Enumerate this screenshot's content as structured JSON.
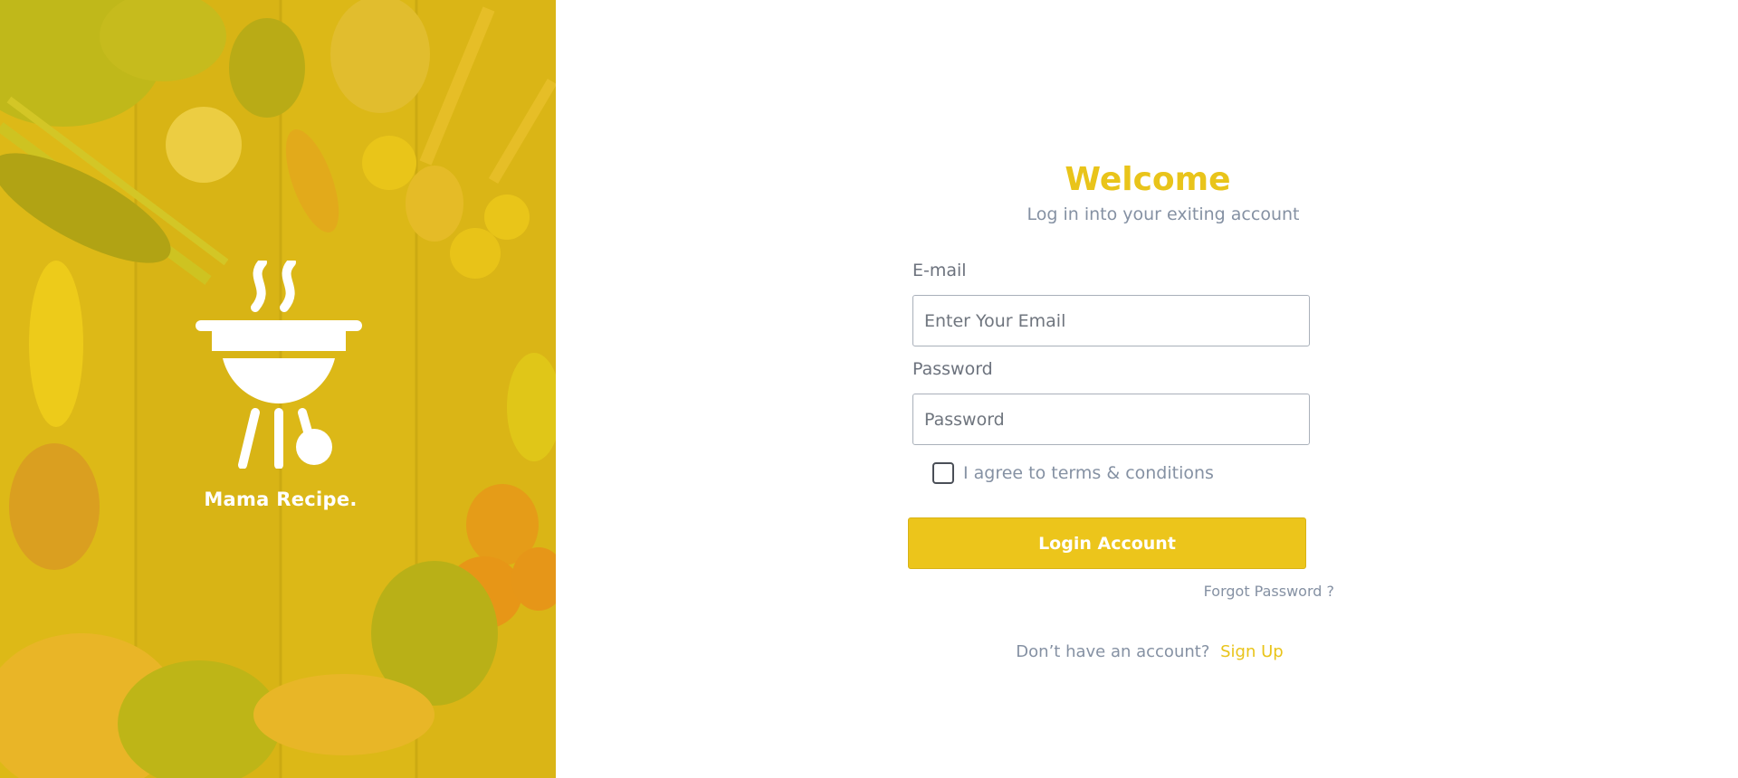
{
  "colors": {
    "accent": "#ecc51b",
    "title": "#e9c41a",
    "muted_text": "#8591a3",
    "label_text": "#6c727d",
    "input_border": "#a9b0ba"
  },
  "hero": {
    "background": "yellow-tinted-food-photo",
    "logo_icon": "grill-bbq-icon",
    "brand_name": "Mama Recipe."
  },
  "login": {
    "title": "Welcome",
    "subtitle": "Log in into your exiting account",
    "email": {
      "label": "E-mail",
      "placeholder": "Enter Your Email",
      "value": ""
    },
    "password": {
      "label": "Password",
      "placeholder": "Password",
      "value": ""
    },
    "agree": {
      "label": "I agree to terms & conditions",
      "checked": false
    },
    "submit_label": "Login Account",
    "forgot_label": "Forgot Password ?",
    "signup_prompt": "Don’t have an account?",
    "signup_link": "Sign Up"
  }
}
